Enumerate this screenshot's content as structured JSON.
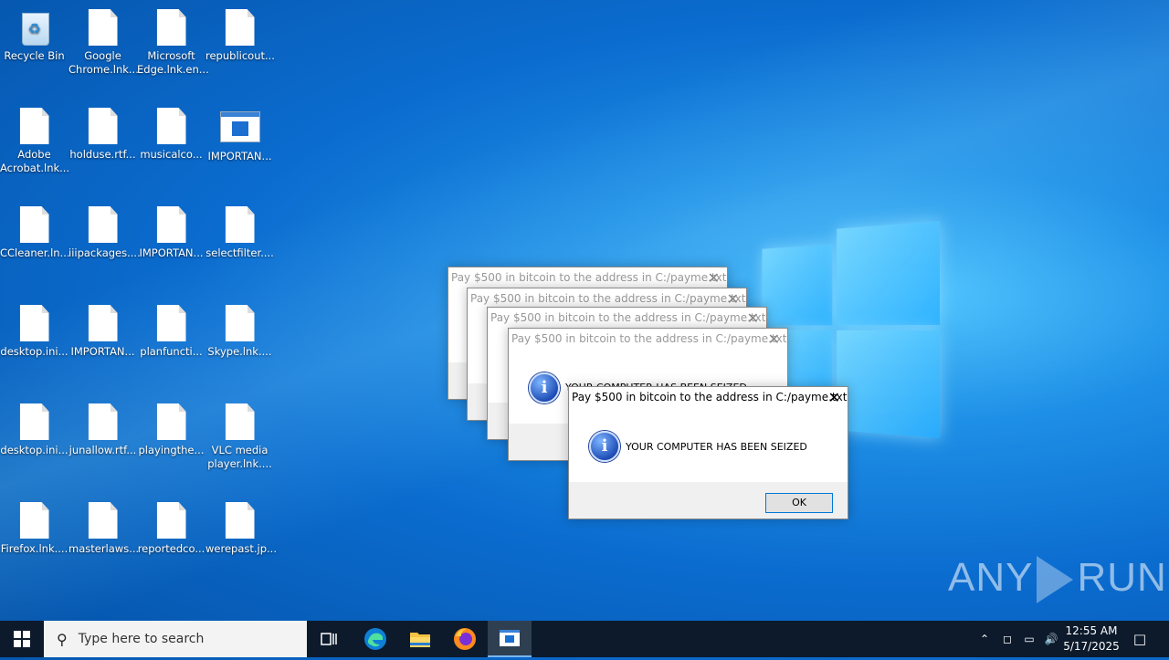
{
  "desktop": {
    "icons": [
      {
        "label": "Recycle Bin",
        "type": "recycle"
      },
      {
        "label": "Google Chrome.lnk...",
        "type": "doc"
      },
      {
        "label": "Microsoft Edge.lnk.en...",
        "type": "doc"
      },
      {
        "label": "republicout...",
        "type": "doc"
      },
      {
        "label": "Adobe Acrobat.lnk...",
        "type": "doc"
      },
      {
        "label": "holduse.rtf...",
        "type": "doc"
      },
      {
        "label": "musicalco...",
        "type": "doc"
      },
      {
        "label": "IMPORTAN...",
        "type": "app"
      },
      {
        "label": "CCleaner.ln...",
        "type": "doc"
      },
      {
        "label": "iiipackages....",
        "type": "doc"
      },
      {
        "label": "IMPORTAN...",
        "type": "doc"
      },
      {
        "label": "selectfilter....",
        "type": "doc"
      },
      {
        "label": "desktop.ini...",
        "type": "doc"
      },
      {
        "label": "IMPORTAN...",
        "type": "doc"
      },
      {
        "label": "planfuncti...",
        "type": "doc"
      },
      {
        "label": "Skype.lnk....",
        "type": "doc"
      },
      {
        "label": "desktop.ini...",
        "type": "doc"
      },
      {
        "label": "junallow.rtf...",
        "type": "doc"
      },
      {
        "label": "playingthe...",
        "type": "doc"
      },
      {
        "label": "VLC media player.lnk....",
        "type": "doc"
      },
      {
        "label": "Firefox.lnk....",
        "type": "doc"
      },
      {
        "label": "masterlaws...",
        "type": "doc"
      },
      {
        "label": "reportedco...",
        "type": "doc"
      },
      {
        "label": "werepast.jp...",
        "type": "doc"
      }
    ]
  },
  "dialogs": {
    "title": "Pay $500 in bitcoin to the address in C:/payme.txt",
    "message": "YOUR COMPUTER HAS BEEN SEIZED",
    "ok_label": "OK",
    "close_glyph": "✕"
  },
  "watermark": {
    "left": "ANY",
    "right": "RUN"
  },
  "taskbar": {
    "search_placeholder": "Type here to search",
    "time": "12:55 AM",
    "date": "5/17/2025"
  },
  "colors": {
    "accent": "#0078d7",
    "taskbar": "#0c1a2b"
  }
}
